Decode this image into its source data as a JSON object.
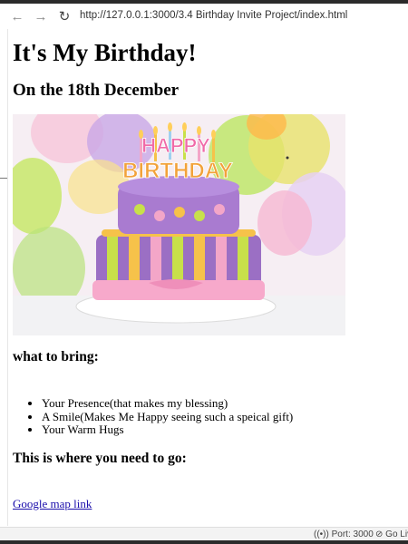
{
  "browser": {
    "back_icon": "←",
    "forward_icon": "→",
    "reload_icon": "↻",
    "url": "http://127.0.0.1:3000/3.4 Birthday Invite Project/index.html"
  },
  "page": {
    "title": "It's My Birthday!",
    "date_heading": "On the 18th December",
    "image_text_top": "HAPPY",
    "image_text_bottom": "BIRTHDAY",
    "bring_heading": "what to bring:",
    "bring_items": [
      "Your Presence(that makes my blessing)",
      "A Smile(Makes Me Happy seeing such a speical gift)",
      "Your Warm Hugs"
    ],
    "location_heading": "This is where you need to go:",
    "map_link": "Google map link"
  },
  "statusbar": {
    "port_icon": "((•))",
    "port_label": "Port: 3000",
    "golive_icon": "⊘",
    "golive_label": "Go Live"
  },
  "colors": {
    "link": "#1a0dab",
    "cake_purple": "#9b6fc4",
    "cake_pink": "#f3a6c8"
  }
}
